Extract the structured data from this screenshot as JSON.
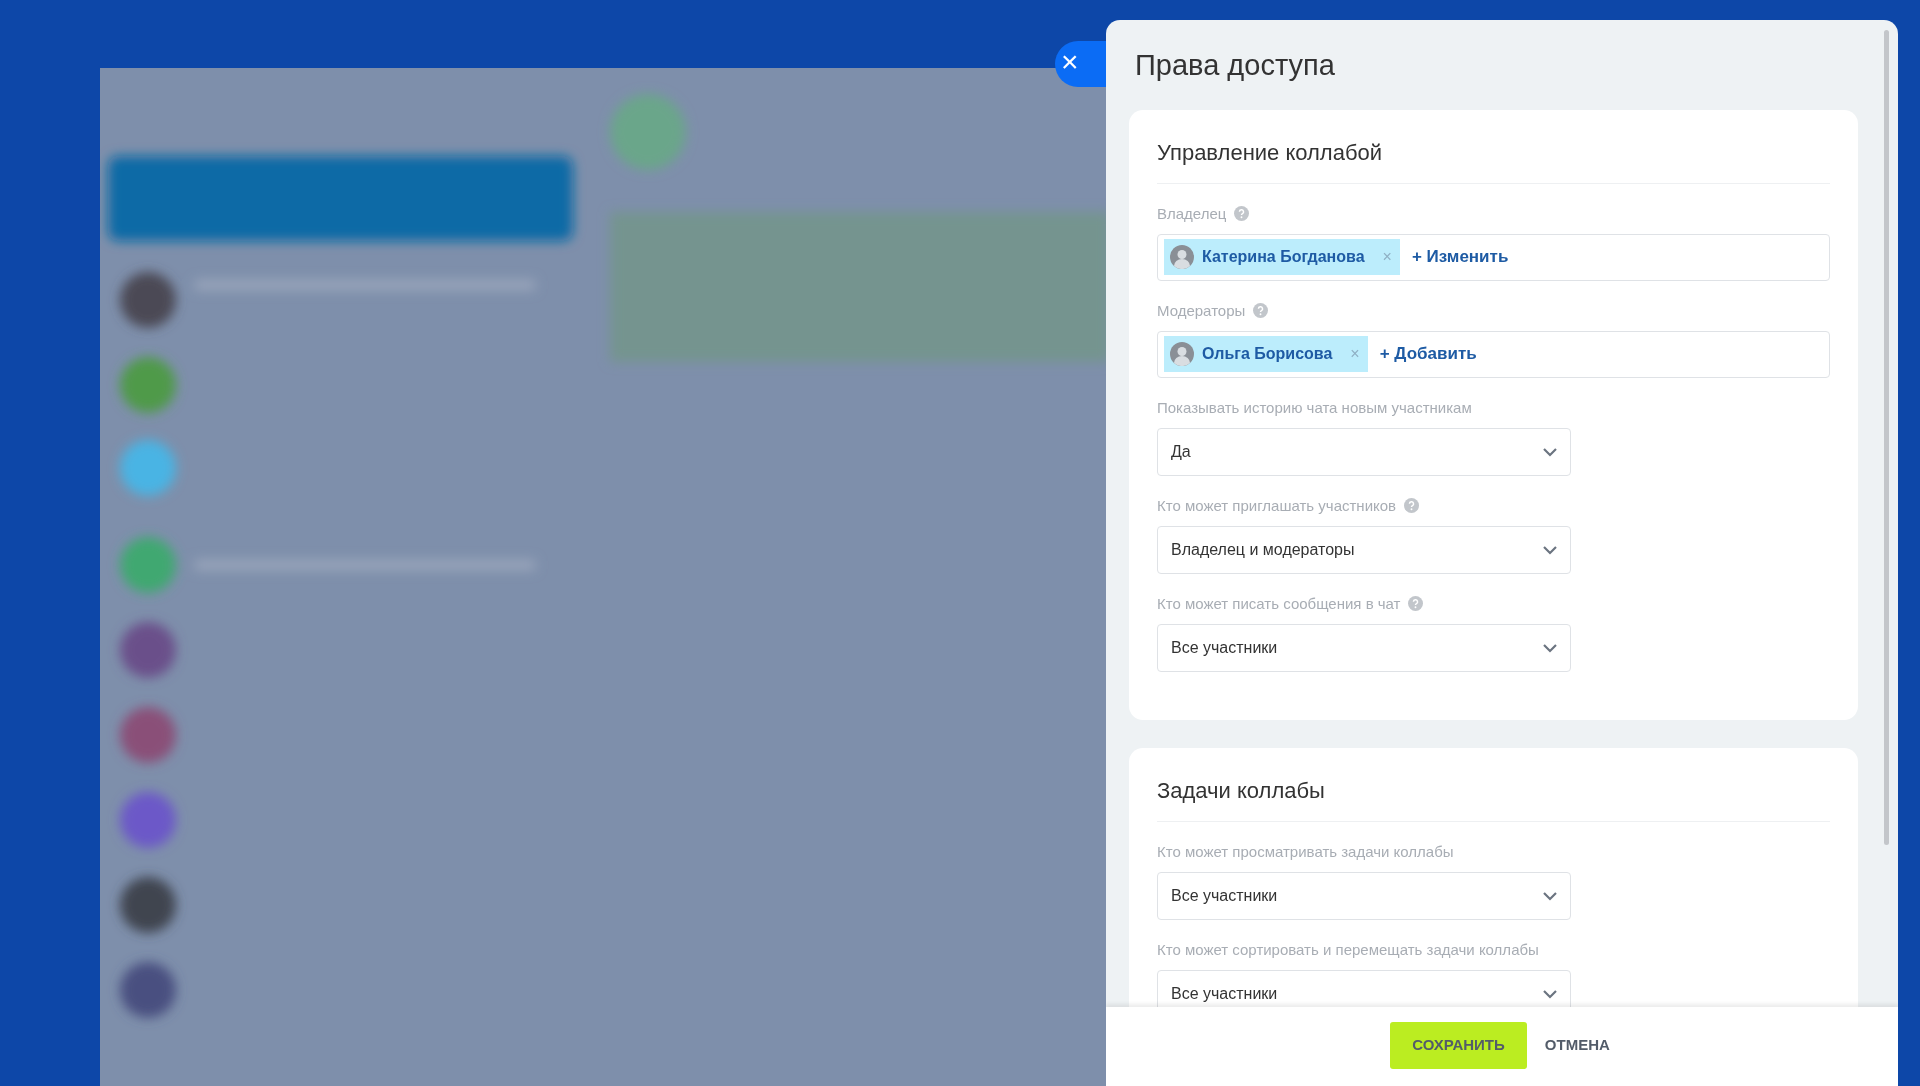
{
  "panel": {
    "title": "Права доступа",
    "close_label": "×"
  },
  "sections": [
    {
      "title": "Управление коллабой",
      "fields": [
        {
          "kind": "people",
          "label": "Владелец",
          "help": true,
          "people": [
            {
              "name": "Катерина Богданова",
              "remove": "×"
            }
          ],
          "action": "+ Изменить"
        },
        {
          "kind": "people",
          "label": "Модераторы",
          "help": true,
          "people": [
            {
              "name": "Ольга Борисова",
              "remove": "×"
            }
          ],
          "action": "+ Добавить"
        },
        {
          "kind": "select",
          "label": "Показывать историю чата новым участникам",
          "help": false,
          "value": "Да"
        },
        {
          "kind": "select",
          "label": "Кто может приглашать участников",
          "help": true,
          "value": "Владелец и модераторы"
        },
        {
          "kind": "select",
          "label": "Кто может писать сообщения в чат",
          "help": true,
          "value": "Все участники"
        }
      ]
    },
    {
      "title": "Задачи коллабы",
      "fields": [
        {
          "kind": "select",
          "label": "Кто может просматривать задачи коллабы",
          "help": false,
          "value": "Все участники"
        },
        {
          "kind": "select",
          "label": "Кто может сортировать и перемещать задачи коллабы",
          "help": false,
          "value": "Все участники"
        }
      ]
    }
  ],
  "footer": {
    "buttons": [
      {
        "kind": "primary",
        "label": "СОХРАНИТЬ"
      },
      {
        "kind": "link",
        "label": "ОТМЕНА"
      }
    ]
  }
}
